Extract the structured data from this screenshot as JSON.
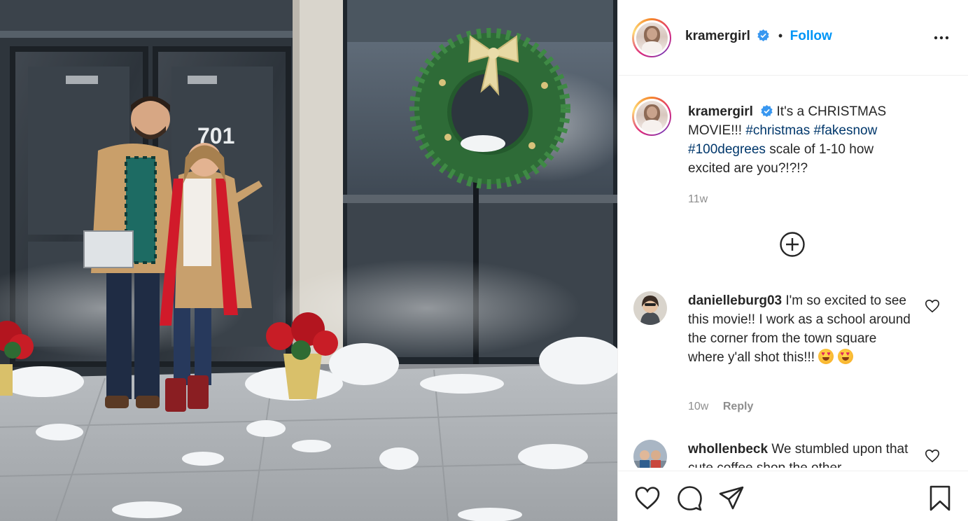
{
  "post": {
    "author": "kramergirl",
    "follow_label": "Follow",
    "separator": "•",
    "caption": {
      "username": "kramergirl",
      "text_before": "It's a CHRISTMAS MOVIE!!! ",
      "hashtags": [
        "#christmas",
        "#fakesnow",
        "#100degrees"
      ],
      "text_after": " scale of 1-10 how excited are you?!?!?",
      "time": "11w"
    },
    "photo": {
      "door_number": "701"
    }
  },
  "comments": [
    {
      "username": "danielleburg03",
      "text": "I'm so excited to see this movie!! I work as a school around the corner from the town square where y'all shot this!!! ",
      "time": "10w",
      "reply_label": "Reply",
      "emoji": "heart-eyes-emoji"
    },
    {
      "username": "whollenbeck",
      "text": "We stumbled upon that cute coffee shop the other"
    }
  ],
  "icons": {
    "verified": "verified-badge-icon",
    "more": "more-options-icon",
    "load_more": "plus-circle-icon",
    "like": "heart-icon",
    "comment": "comment-icon",
    "share": "share-icon",
    "save": "bookmark-icon"
  },
  "colors": {
    "follow": "#0095f6",
    "hashtag": "#00376b",
    "muted": "#8e8e8e",
    "text": "#262626"
  }
}
